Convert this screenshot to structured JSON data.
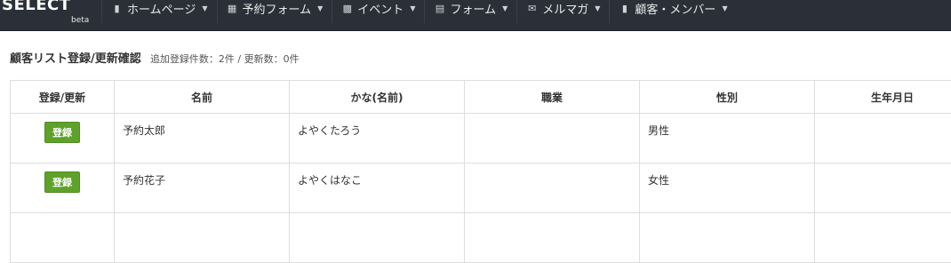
{
  "nav": {
    "brand_name": "SELECT",
    "brand_badge": "beta",
    "items": [
      {
        "label": "ホームページ",
        "icon": "file-icon"
      },
      {
        "label": "予約フォーム",
        "icon": "calendar-icon"
      },
      {
        "label": "イベント",
        "icon": "comment-icon"
      },
      {
        "label": "フォーム",
        "icon": "list-icon"
      },
      {
        "label": "メルマガ",
        "icon": "envelope-icon"
      },
      {
        "label": "顧客・メンバー",
        "icon": "book-icon"
      }
    ]
  },
  "page": {
    "title": "顧客リスト登録/更新確認",
    "summary": "追加登録件数：2件 / 更新数：0件"
  },
  "table": {
    "headers": [
      "登録/更新",
      "名前",
      "かな(名前)",
      "職業",
      "性別",
      "生年月日"
    ],
    "rows": [
      {
        "action": "登録",
        "name": "予約太郎",
        "kana": "よやくたろう",
        "job": "",
        "gender": "男性",
        "birthday": ""
      },
      {
        "action": "登録",
        "name": "予約花子",
        "kana": "よやくはなこ",
        "job": "",
        "gender": "女性",
        "birthday": ""
      }
    ]
  },
  "colors": {
    "navbar": "#2b3038",
    "register_button": "#5fa22a"
  }
}
